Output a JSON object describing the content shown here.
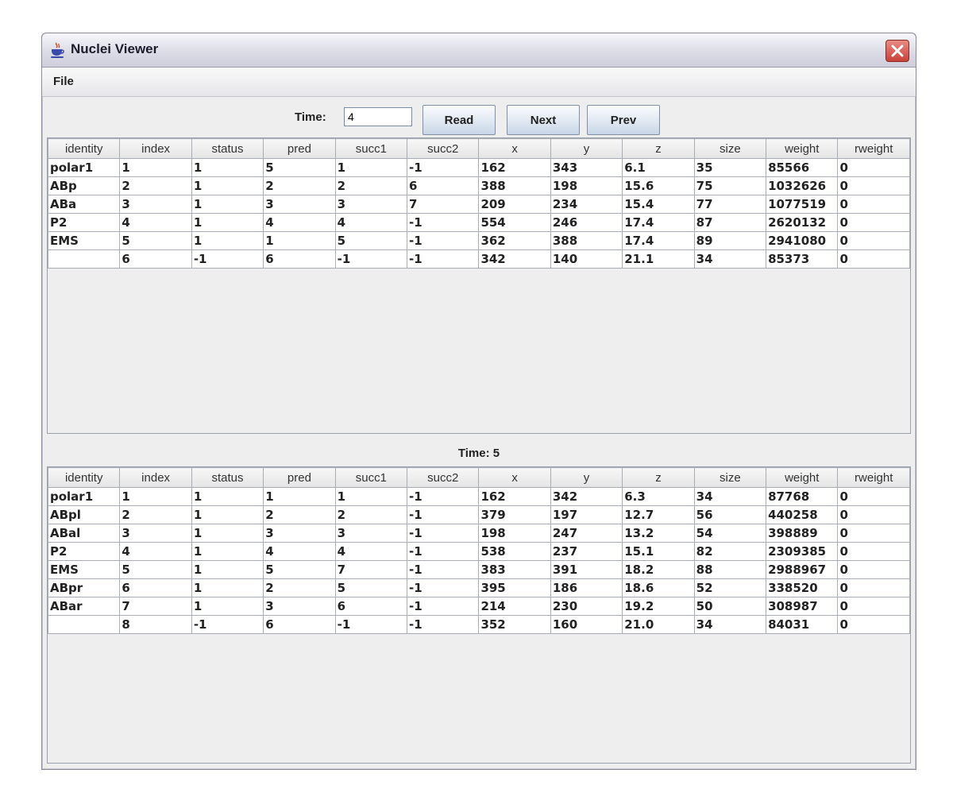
{
  "window": {
    "title": "Nuclei Viewer",
    "app_icon": "java-cup-icon",
    "close_icon": "close-icon"
  },
  "menu": {
    "items": [
      {
        "label": "File"
      }
    ]
  },
  "toolbar": {
    "time_label": "Time:",
    "time_value": "4",
    "read_label": "Read",
    "next_label": "Next",
    "prev_label": "Prev"
  },
  "columns": [
    "identity",
    "index",
    "status",
    "pred",
    "succ1",
    "succ2",
    "x",
    "y",
    "z",
    "size",
    "weight",
    "rweight"
  ],
  "table_top": {
    "rows": [
      [
        "polar1",
        "1",
        "1",
        "5",
        "1",
        "-1",
        "162",
        "343",
        "6.1",
        "35",
        "85566",
        "0"
      ],
      [
        "ABp",
        "2",
        "1",
        "2",
        "2",
        "6",
        "388",
        "198",
        "15.6",
        "75",
        "1032626",
        "0"
      ],
      [
        "ABa",
        "3",
        "1",
        "3",
        "3",
        "7",
        "209",
        "234",
        "15.4",
        "77",
        "1077519",
        "0"
      ],
      [
        "P2",
        "4",
        "1",
        "4",
        "4",
        "-1",
        "554",
        "246",
        "17.4",
        "87",
        "2620132",
        "0"
      ],
      [
        "EMS",
        "5",
        "1",
        "1",
        "5",
        "-1",
        "362",
        "388",
        "17.4",
        "89",
        "2941080",
        "0"
      ],
      [
        "",
        "6",
        "-1",
        "6",
        "-1",
        "-1",
        "342",
        "140",
        "21.1",
        "34",
        "85373",
        "0"
      ]
    ]
  },
  "bottom_panel": {
    "title": "Time: 5"
  },
  "table_bottom": {
    "rows": [
      [
        "polar1",
        "1",
        "1",
        "1",
        "1",
        "-1",
        "162",
        "342",
        "6.3",
        "34",
        "87768",
        "0"
      ],
      [
        "ABpl",
        "2",
        "1",
        "2",
        "2",
        "-1",
        "379",
        "197",
        "12.7",
        "56",
        "440258",
        "0"
      ],
      [
        "ABal",
        "3",
        "1",
        "3",
        "3",
        "-1",
        "198",
        "247",
        "13.2",
        "54",
        "398889",
        "0"
      ],
      [
        "P2",
        "4",
        "1",
        "4",
        "4",
        "-1",
        "538",
        "237",
        "15.1",
        "82",
        "2309385",
        "0"
      ],
      [
        "EMS",
        "5",
        "1",
        "5",
        "7",
        "-1",
        "383",
        "391",
        "18.2",
        "88",
        "2988967",
        "0"
      ],
      [
        "ABpr",
        "6",
        "1",
        "2",
        "5",
        "-1",
        "395",
        "186",
        "18.6",
        "52",
        "338520",
        "0"
      ],
      [
        "ABar",
        "7",
        "1",
        "3",
        "6",
        "-1",
        "214",
        "230",
        "19.2",
        "50",
        "308987",
        "0"
      ],
      [
        "",
        "8",
        "-1",
        "6",
        "-1",
        "-1",
        "352",
        "160",
        "21.0",
        "34",
        "84031",
        "0"
      ]
    ]
  }
}
